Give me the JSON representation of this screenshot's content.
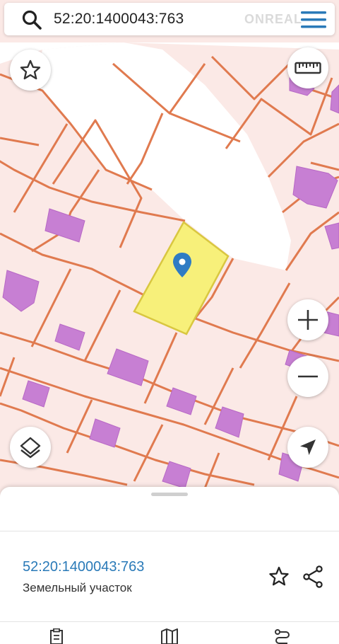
{
  "search": {
    "query": "52:20:1400043:763",
    "watermark": "ONREAL"
  },
  "map": {
    "highlighted_parcel_color": "#f7f07a",
    "boundary_color": "#e07a4f",
    "building_color": "#c77fd3",
    "background_color": "#fbe9e6"
  },
  "controls": {
    "favorite_icon": "star-icon",
    "ruler_icon": "ruler-icon",
    "zoom_in_icon": "plus-icon",
    "zoom_out_icon": "minus-icon",
    "layers_icon": "layers-icon",
    "locate_icon": "navigation-arrow-icon"
  },
  "sheet": {
    "parcel_number": "52:20:1400043:763",
    "parcel_type": "Земельный участок",
    "actions": [
      "star-icon",
      "share-icon"
    ],
    "bottom_nav": [
      "document-icon",
      "map-icon",
      "route-icon"
    ]
  }
}
